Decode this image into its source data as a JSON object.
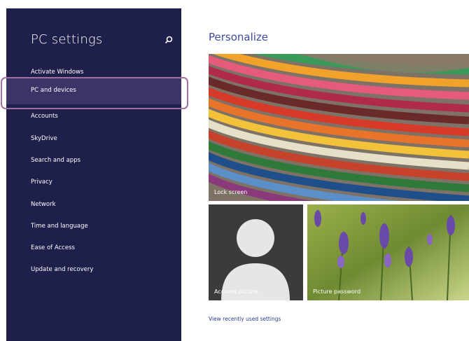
{
  "sidebar": {
    "title": "PC settings",
    "items": [
      {
        "label": "Activate Windows"
      },
      {
        "label": "PC and devices"
      },
      {
        "label": "Accounts"
      },
      {
        "label": "SkyDrive"
      },
      {
        "label": "Search and apps"
      },
      {
        "label": "Privacy"
      },
      {
        "label": "Network"
      },
      {
        "label": "Time and language"
      },
      {
        "label": "Ease of Access"
      },
      {
        "label": "Update and recovery"
      }
    ],
    "selected_index": 1
  },
  "main": {
    "title": "Personalize",
    "tiles": {
      "lock_screen": "Lock screen",
      "account_picture": "Account picture",
      "picture_password": "Picture password"
    },
    "recent_link": "View recently used settings"
  },
  "colors": {
    "sidebar_bg": "#1e1f4a",
    "selected_bg": "#3a3566",
    "highlight_border": "#a06fa0",
    "title_color": "#3e4a9e"
  }
}
